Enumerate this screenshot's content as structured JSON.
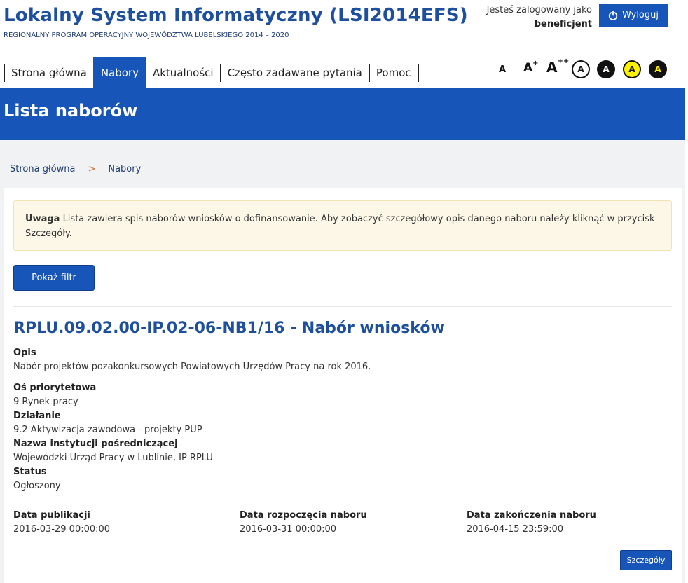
{
  "header": {
    "title": "Lokalny System Informatyczny (LSI2014EFS)",
    "subtitle": "REGIONALNY PROGRAM OPERACYJNY WOJEWÓDZTWA LUBELSKIEGO 2014 – 2020",
    "user_line1": "Jesteś zalogowany jako",
    "user_role": "beneficjent",
    "logout_label": "Wyloguj",
    "logout_icon": "power-icon"
  },
  "nav": {
    "items": [
      {
        "label": "Strona główna",
        "active": false
      },
      {
        "label": "Nabory",
        "active": true
      },
      {
        "label": "Aktualności",
        "active": false
      },
      {
        "label": "Często zadawane pytania",
        "active": false
      },
      {
        "label": "Pomoc",
        "active": false
      }
    ]
  },
  "accessibility": {
    "font_small": "A",
    "font_medium": "A",
    "font_medium_sup": "+",
    "font_large": "A",
    "font_large_sup": "++",
    "contrast_default": "A",
    "contrast_black": "A",
    "contrast_yellow": "A",
    "contrast_black_yellow": "A"
  },
  "page": {
    "title": "Lista naborów"
  },
  "breadcrumb": {
    "home": "Strona główna",
    "separator": ">",
    "current": "Nabory"
  },
  "alert": {
    "label": "Uwaga",
    "text": "Lista zawiera spis naborów wniosków o dofinansowanie. Aby zobaczyć szczegółowy opis danego naboru należy kliknąć w przycisk Szczegóły."
  },
  "filter_button_label": "Pokaż filtr",
  "record": {
    "title": "RPLU.09.02.00-IP.02-06-NB1/16 - Nabór wniosków",
    "description_label": "Opis",
    "description": "Nabór projektów pozakonkursowych Powiatowych Urzędów Pracy na rok 2016.",
    "axis_label": "Oś priorytetowa",
    "axis": "9 Rynek pracy",
    "action_label": "Działanie",
    "action": "9.2 Aktywizacja zawodowa - projekty PUP",
    "institution_label": "Nazwa instytucji pośredniczącej",
    "institution": "Wojewódzki Urząd Pracy w Lublinie, IP RPLU",
    "status_label": "Status",
    "status": "Ogłoszony",
    "published_label": "Data publikacji",
    "published": "2016-03-29 00:00:00",
    "start_label": "Data rozpoczęcia naboru",
    "start": "2016-03-31 00:00:00",
    "end_label": "Data zakończenia naboru",
    "end": "2016-04-15 23:59:00",
    "details_label": "Szczegóły"
  },
  "colors": {
    "primary": "#1756b8",
    "title_blue": "#1d4f9c",
    "alert_bg": "#fcf7e6",
    "breadcrumb_separator": "#e0733a",
    "page_bg": "#f1f2f4"
  }
}
